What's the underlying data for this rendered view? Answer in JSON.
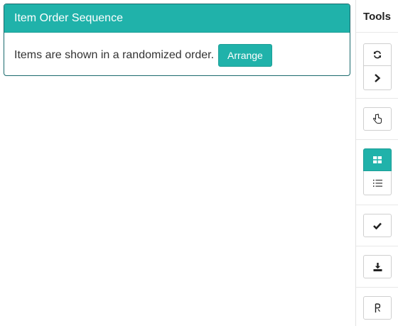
{
  "panel": {
    "title": "Item Order Sequence",
    "message": "Items are shown in a randomized order.",
    "arrange_label": "Arrange"
  },
  "tools": {
    "title": "Tools",
    "buttons": [
      {
        "name": "refresh-icon"
      },
      {
        "name": "chevron-right-icon"
      },
      {
        "name": "hand-pointer-icon"
      },
      {
        "name": "grid-icon"
      },
      {
        "name": "list-icon"
      },
      {
        "name": "check-icon"
      },
      {
        "name": "download-icon"
      },
      {
        "name": "parser-icon"
      }
    ]
  },
  "colors": {
    "accent": "#20b2aa",
    "border": "#1a6a6d"
  }
}
